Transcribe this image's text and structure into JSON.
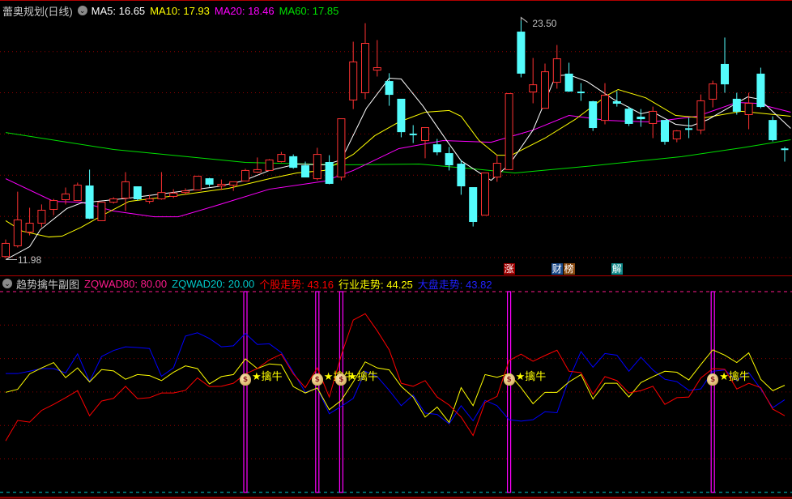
{
  "main_header": {
    "title": "蕾奥规划(日线)",
    "ma5": "MA5: 16.65",
    "ma10": "MA10: 17.93",
    "ma20": "MA20: 18.46",
    "ma60": "MA60: 17.85"
  },
  "sub_header": {
    "title": "趋势擒牛副图",
    "zqwad80": "ZQWAD80: 80.00",
    "zqwad20": "ZQWAD20: 20.00",
    "stock_trend": "个股走势: 43.16",
    "industry_trend": "行业走势: 44.25",
    "market_trend": "大盘走势: 43.82"
  },
  "colors": {
    "up": "#ff3232",
    "down": "#54fcfc",
    "ma5": "#ffffff",
    "ma10": "#ffff00",
    "ma20": "#ff00ff",
    "ma60": "#00e000",
    "stock": "#ff0000",
    "industry": "#ffff00",
    "market": "#0000ff",
    "signal": "#ff00ff",
    "grid": "#8b0000",
    "border": "#b00000"
  },
  "badges": [
    {
      "text": "涨",
      "index": 42,
      "color": "#a00000"
    },
    {
      "text": "财",
      "index": 46,
      "color": "#1a4a8a"
    },
    {
      "text": "榜",
      "index": 47,
      "color": "#8a4a10"
    },
    {
      "text": "解",
      "index": 51,
      "color": "#108a8a"
    }
  ],
  "chart_data": [
    {
      "type": "candlestick",
      "title": "蕾奥规划(日线)",
      "ylim": [
        11.9,
        23.6
      ],
      "grid_values": [
        12,
        14,
        16,
        18,
        20,
        22
      ],
      "high_label": "23.50",
      "low_label": "11.98",
      "high_index": 43,
      "low_index": 0,
      "ohlc": [
        [
          12.05,
          12.88,
          11.98,
          12.69
        ],
        [
          12.57,
          15.2,
          12.49,
          13.83
        ],
        [
          13.24,
          14.42,
          13.08,
          13.67
        ],
        [
          13.67,
          14.58,
          13.47,
          14.3
        ],
        [
          14.34,
          14.85,
          14.06,
          14.77
        ],
        [
          14.81,
          15.4,
          14.58,
          15.09
        ],
        [
          14.77,
          15.64,
          14.77,
          15.52
        ],
        [
          15.48,
          16.27,
          13.87,
          13.91
        ],
        [
          13.79,
          14.69,
          13.79,
          14.69
        ],
        [
          14.69,
          14.93,
          14.62,
          14.85
        ],
        [
          14.89,
          16.15,
          14.26,
          15.68
        ],
        [
          15.44,
          15.44,
          14.77,
          14.85
        ],
        [
          14.73,
          15.05,
          14.62,
          14.85
        ],
        [
          14.85,
          16.15,
          14.81,
          15.16
        ],
        [
          14.97,
          15.32,
          14.89,
          15.13
        ],
        [
          15.16,
          15.36,
          15.05,
          15.24
        ],
        [
          15.28,
          15.95,
          15.28,
          15.95
        ],
        [
          15.83,
          15.87,
          15.44,
          15.56
        ],
        [
          15.48,
          15.79,
          15.28,
          15.56
        ],
        [
          15.52,
          15.68,
          15.24,
          15.68
        ],
        [
          15.72,
          16.31,
          15.72,
          16.23
        ],
        [
          16.15,
          16.86,
          16.11,
          16.27
        ],
        [
          16.23,
          16.78,
          16.23,
          16.74
        ],
        [
          16.66,
          17.13,
          16.62,
          17.01
        ],
        [
          16.9,
          17.01,
          16.31,
          16.38
        ],
        [
          16.46,
          16.66,
          15.91,
          15.91
        ],
        [
          15.83,
          17.33,
          15.75,
          17.01
        ],
        [
          16.62,
          16.97,
          15.56,
          15.6
        ],
        [
          15.91,
          18.74,
          15.75,
          18.74
        ],
        [
          19.65,
          22.48,
          19.21,
          21.5
        ],
        [
          20.0,
          23.38,
          19.69,
          22.4
        ],
        [
          21.1,
          22.56,
          20.79,
          21.22
        ],
        [
          20.55,
          20.95,
          19.37,
          19.92
        ],
        [
          19.69,
          19.69,
          17.84,
          18.11
        ],
        [
          17.98,
          18.43,
          17.56,
          17.96
        ],
        [
          17.68,
          18.31,
          16.82,
          18.31
        ],
        [
          17.48,
          17.76,
          16.97,
          17.13
        ],
        [
          17.05,
          17.37,
          16.23,
          16.5
        ],
        [
          16.54,
          16.74,
          15.05,
          15.48
        ],
        [
          15.4,
          15.4,
          13.51,
          13.75
        ],
        [
          14.06,
          16.11,
          14.06,
          16.11
        ],
        [
          15.91,
          16.97,
          15.68,
          16.58
        ],
        [
          16.27,
          19.96,
          16.27,
          19.96
        ],
        [
          22.95,
          23.5,
          20.75,
          20.95
        ],
        [
          20.04,
          21.69,
          19.49,
          20.39
        ],
        [
          19.25,
          21.42,
          19.25,
          21.02
        ],
        [
          20.51,
          22.32,
          20.2,
          21.65
        ],
        [
          20.91,
          21.46,
          20.04,
          20.08
        ],
        [
          20.02,
          20.47,
          19.61,
          20.0
        ],
        [
          19.57,
          19.61,
          18.15,
          18.31
        ],
        [
          18.66,
          20.47,
          18.47,
          19.88
        ],
        [
          19.57,
          20.08,
          19.33,
          19.49
        ],
        [
          19.21,
          19.33,
          18.39,
          18.51
        ],
        [
          18.82,
          19.21,
          18.35,
          18.74
        ],
        [
          18.51,
          19.33,
          17.8,
          19.1
        ],
        [
          18.66,
          18.66,
          17.48,
          17.64
        ],
        [
          17.76,
          18.19,
          17.6,
          18.15
        ],
        [
          18.24,
          18.78,
          17.8,
          18.22
        ],
        [
          18.19,
          19.92,
          17.99,
          19.61
        ],
        [
          19.69,
          20.59,
          19.29,
          20.43
        ],
        [
          21.38,
          22.68,
          20.0,
          20.43
        ],
        [
          19.69,
          20.0,
          18.94,
          19.1
        ],
        [
          18.94,
          20.0,
          18.23,
          19.49
        ],
        [
          20.91,
          21.22,
          19.25,
          19.33
        ],
        [
          18.66,
          18.86,
          17.64,
          17.72
        ],
        [
          17.26,
          17.37,
          16.66,
          17.25
        ]
      ],
      "series": [
        {
          "name": "MA5",
          "points": [
            [
              0,
              11.9
            ],
            [
              2,
              12.53
            ],
            [
              2.9,
              13.36
            ],
            [
              5.1,
              14.38
            ],
            [
              6.3,
              14.65
            ],
            [
              10.3,
              14.89
            ],
            [
              13.9,
              15.16
            ],
            [
              17.6,
              15.44
            ],
            [
              19.8,
              15.72
            ],
            [
              22,
              16.23
            ],
            [
              24.3,
              16.54
            ],
            [
              26.6,
              16.5
            ],
            [
              28,
              16.74
            ],
            [
              30.1,
              19.25
            ],
            [
              32,
              20.71
            ],
            [
              33,
              20.67
            ],
            [
              34.8,
              19.37
            ],
            [
              36.8,
              17.68
            ],
            [
              38,
              16.7
            ],
            [
              40.5,
              15.75
            ],
            [
              42,
              16.5
            ],
            [
              44,
              18.19
            ],
            [
              45.9,
              20.83
            ],
            [
              47,
              20.87
            ],
            [
              48.5,
              20.55
            ],
            [
              50.7,
              19.69
            ],
            [
              53,
              18.98
            ],
            [
              53.9,
              19.1
            ],
            [
              55.9,
              18.47
            ],
            [
              57.2,
              18.39
            ],
            [
              58.6,
              18.7
            ],
            [
              61.9,
              19.8
            ],
            [
              62.9,
              19.69
            ],
            [
              65.5,
              18.27
            ]
          ]
        },
        {
          "name": "MA10",
          "points": [
            [
              0,
              13.79
            ],
            [
              1.4,
              13.28
            ],
            [
              3.6,
              13.0
            ],
            [
              4.7,
              13.04
            ],
            [
              6.3,
              13.47
            ],
            [
              8.1,
              14.06
            ],
            [
              10.3,
              14.73
            ],
            [
              14.2,
              15.01
            ],
            [
              18.6,
              15.36
            ],
            [
              22,
              15.83
            ],
            [
              24.3,
              16.11
            ],
            [
              26.6,
              16.23
            ],
            [
              29,
              17.01
            ],
            [
              30.8,
              17.92
            ],
            [
              32.8,
              18.58
            ],
            [
              35,
              19.06
            ],
            [
              37,
              19.14
            ],
            [
              38,
              18.86
            ],
            [
              39.5,
              17.68
            ],
            [
              41,
              16.97
            ],
            [
              42.2,
              16.97
            ],
            [
              45,
              17.8
            ],
            [
              47.5,
              18.7
            ],
            [
              50.2,
              19.88
            ],
            [
              51.1,
              20.16
            ],
            [
              53.4,
              19.76
            ],
            [
              55.9,
              18.9
            ],
            [
              58.2,
              18.78
            ],
            [
              61.4,
              19.1
            ],
            [
              65.5,
              18.86
            ]
          ]
        },
        {
          "name": "MA20",
          "points": [
            [
              0,
              15.83
            ],
            [
              4,
              14.73
            ],
            [
              6.3,
              14.69
            ],
            [
              9,
              14.26
            ],
            [
              12.4,
              13.98
            ],
            [
              14.4,
              13.98
            ],
            [
              17.6,
              14.53
            ],
            [
              22,
              15.32
            ],
            [
              26.6,
              15.71
            ],
            [
              29,
              16.23
            ],
            [
              32.8,
              17.29
            ],
            [
              36.5,
              17.68
            ],
            [
              40.5,
              17.6
            ],
            [
              44,
              18.19
            ],
            [
              47,
              18.9
            ],
            [
              50.2,
              18.66
            ],
            [
              53.9,
              18.58
            ],
            [
              57.7,
              18.86
            ],
            [
              61,
              19.53
            ],
            [
              62.6,
              19.49
            ],
            [
              65.5,
              19.06
            ]
          ]
        },
        {
          "name": "MA60",
          "points": [
            [
              0,
              18.07
            ],
            [
              9,
              17.25
            ],
            [
              20,
              16.62
            ],
            [
              28,
              16.5
            ],
            [
              34.5,
              16.54
            ],
            [
              39,
              16.31
            ],
            [
              42.5,
              16.11
            ],
            [
              49,
              16.46
            ],
            [
              56.4,
              16.9
            ],
            [
              61.4,
              17.33
            ],
            [
              65.5,
              17.72
            ]
          ]
        }
      ]
    },
    {
      "type": "line",
      "title": "趋势擒牛副图",
      "ylim": [
        20,
        80
      ],
      "grid_values": [
        30,
        40,
        50,
        60,
        70
      ],
      "reference_lines": [
        {
          "name": "ZQWAD80",
          "value": 80
        },
        {
          "name": "ZQWAD20",
          "value": 20
        }
      ],
      "series": [
        {
          "name": "个股走势",
          "values": [
            35.4,
            41.5,
            41.0,
            44.5,
            46.3,
            48.3,
            50.4,
            42.9,
            47.3,
            48.1,
            51.7,
            48.0,
            48.3,
            49.7,
            49.7,
            50.5,
            54.2,
            51.6,
            51.7,
            52.6,
            55.4,
            57.0,
            59.6,
            61.3,
            55.4,
            51.3,
            57.2,
            48.5,
            61.0,
            71.5,
            73.4,
            68.3,
            62.6,
            52.6,
            51.7,
            53.4,
            48.5,
            46.1,
            42.5,
            37.0,
            46.9,
            48.7,
            59.4,
            61.3,
            59.2,
            60.9,
            62.5,
            56.2,
            55.8,
            49.3,
            54.6,
            53.4,
            49.7,
            50.4,
            51.7,
            46.3,
            48.3,
            48.5,
            54.2,
            57.0,
            56.8,
            50.9,
            52.6,
            51.3,
            44.9,
            42.9
          ]
        },
        {
          "name": "行业走势",
          "values": [
            49.9,
            50.8,
            55.4,
            57.2,
            58.8,
            54.3,
            57.2,
            53.0,
            56.7,
            56.3,
            53.8,
            55.2,
            54.9,
            53.4,
            55.9,
            57.8,
            57.0,
            52.4,
            54.6,
            55.2,
            59.9,
            57.0,
            58.4,
            58.1,
            51.6,
            49.7,
            51.2,
            44.7,
            47.5,
            53.0,
            59.0,
            57.2,
            56.6,
            51.7,
            48.5,
            42.5,
            45.5,
            40.9,
            51.3,
            45.9,
            55.2,
            54.4,
            55.5,
            51.3,
            46.5,
            49.9,
            49.9,
            53.0,
            55.2,
            47.9,
            52.6,
            52.6,
            48.5,
            52.8,
            54.6,
            56.2,
            55.9,
            53.6,
            58.2,
            62.6,
            61.0,
            58.8,
            61.7,
            53.8,
            50.4,
            52.0
          ]
        },
        {
          "name": "大盘走势",
          "values": [
            55.5,
            55.5,
            56.2,
            57.0,
            57.0,
            55.7,
            61.4,
            53.1,
            60.6,
            62.4,
            63.5,
            63.3,
            63.0,
            54.7,
            57.2,
            66.7,
            67.7,
            66.0,
            63.5,
            63.8,
            67.5,
            64.2,
            64.4,
            61.8,
            55.9,
            49.9,
            51.2,
            43.5,
            45.7,
            48.1,
            56.2,
            54.6,
            50.5,
            45.9,
            49.1,
            43.7,
            43.3,
            40.5,
            45.9,
            41.4,
            47.5,
            45.9,
            41.7,
            41.3,
            41.7,
            44.1,
            43.8,
            53.8,
            62.1,
            57.4,
            61.5,
            61.0,
            56.2,
            60.4,
            56.6,
            53.8,
            53.1,
            50.5,
            50.9,
            56.2,
            56.6,
            53.4,
            55.8,
            50.9,
            45.3,
            47.7
          ]
        }
      ],
      "signals": [
        {
          "index": 20,
          "label": "★擒牛"
        },
        {
          "index": 26,
          "label": "★擒牛"
        },
        {
          "index": 28,
          "label": "★擒牛"
        },
        {
          "index": 42,
          "label": "★擒牛"
        },
        {
          "index": 59,
          "label": "★擒牛"
        }
      ]
    }
  ]
}
